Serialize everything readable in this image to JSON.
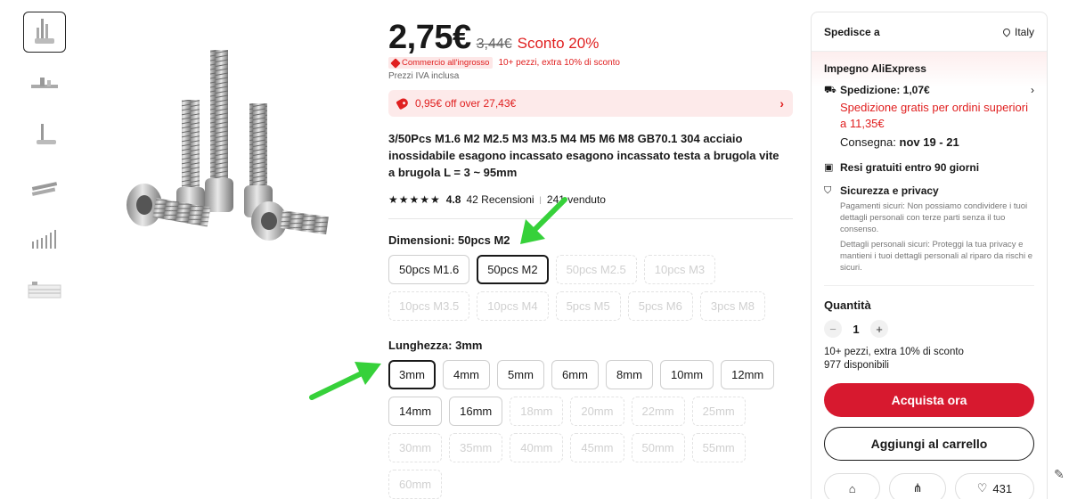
{
  "price": {
    "current": "2,75€",
    "old": "3,44€",
    "discount": "Sconto 20%",
    "wholesale_badge": "Commercio all'ingrosso",
    "wholesale_text": "10+ pezzi, extra 10% di sconto",
    "vat": "Prezzi IVA inclusa"
  },
  "coupon": {
    "text": "0,95€ off over 27,43€"
  },
  "product": {
    "title": "3/50Pcs M1.6 M2 M2.5 M3 M3.5 M4 M5 M6 M8 GB70.1 304 acciaio inossidabile esagono incassato esagono incassato testa a brugola vite a brugola L = 3 ~ 95mm"
  },
  "rating": {
    "stars": "★★★★★",
    "value": "4.8",
    "reviews": "42 Recensioni",
    "separator": "|",
    "sold": "241 venduto"
  },
  "dimensions": {
    "label": "Dimensioni: 50pcs M2",
    "options": [
      {
        "label": "50pcs M1.6",
        "state": "normal"
      },
      {
        "label": "50pcs M2",
        "state": "selected"
      },
      {
        "label": "50pcs M2.5",
        "state": "disabled"
      },
      {
        "label": "10pcs M3",
        "state": "disabled"
      },
      {
        "label": "10pcs M3.5",
        "state": "disabled"
      },
      {
        "label": "10pcs M4",
        "state": "disabled"
      },
      {
        "label": "5pcs M5",
        "state": "disabled"
      },
      {
        "label": "5pcs M6",
        "state": "disabled"
      },
      {
        "label": "3pcs M8",
        "state": "disabled"
      }
    ]
  },
  "length": {
    "label": "Lunghezza: 3mm",
    "options": [
      {
        "label": "3mm",
        "state": "selected"
      },
      {
        "label": "4mm",
        "state": "normal"
      },
      {
        "label": "5mm",
        "state": "normal"
      },
      {
        "label": "6mm",
        "state": "normal"
      },
      {
        "label": "8mm",
        "state": "normal"
      },
      {
        "label": "10mm",
        "state": "normal"
      },
      {
        "label": "12mm",
        "state": "normal"
      },
      {
        "label": "14mm",
        "state": "normal"
      },
      {
        "label": "16mm",
        "state": "normal"
      },
      {
        "label": "18mm",
        "state": "disabled"
      },
      {
        "label": "20mm",
        "state": "disabled"
      },
      {
        "label": "22mm",
        "state": "disabled"
      },
      {
        "label": "25mm",
        "state": "disabled"
      },
      {
        "label": "30mm",
        "state": "disabled"
      },
      {
        "label": "35mm",
        "state": "disabled"
      },
      {
        "label": "40mm",
        "state": "disabled"
      },
      {
        "label": "45mm",
        "state": "disabled"
      },
      {
        "label": "50mm",
        "state": "disabled"
      },
      {
        "label": "55mm",
        "state": "disabled"
      },
      {
        "label": "60mm",
        "state": "disabled"
      }
    ]
  },
  "panel": {
    "ship_to_label": "Spedisce a",
    "ship_to_country": "Italy",
    "commitment_title": "Impegno AliExpress",
    "shipping_label": "Spedizione: 1,07€",
    "free_shipping": "Spedizione gratis per ordini superiori a 11,35€",
    "delivery_prefix": "Consegna:",
    "delivery_dates": "nov 19 - 21",
    "returns": "Resi gratuiti entro 90 giorni",
    "security_title": "Sicurezza e privacy",
    "security_p1": "Pagamenti sicuri: Non possiamo condividere i tuoi dettagli personali con terze parti senza il tuo consenso.",
    "security_p2": "Dettagli personali sicuri: Proteggi la tua privacy e mantieni i tuoi dettagli personali al riparo da rischi e sicuri.",
    "quantity_title": "Quantità",
    "quantity_value": "1",
    "minus": "−",
    "plus": "+",
    "qty_note1": "10+ pezzi, extra 10% di sconto",
    "qty_note2": "977 disponibili",
    "buy_now": "Acquista ora",
    "add_to_cart": "Aggiungi al carrello",
    "likes": "431"
  },
  "icons": {
    "pin": "location-pin-icon",
    "truck": "truck-icon",
    "returns": "return-box-icon",
    "shield": "shield-icon",
    "store": "store-icon",
    "share": "share-icon",
    "heart": "heart-icon",
    "pencil": "pencil-icon"
  },
  "colors": {
    "accent_red": "#e02020",
    "buy_button": "#d7192f",
    "arrow_green": "#36d13a"
  }
}
